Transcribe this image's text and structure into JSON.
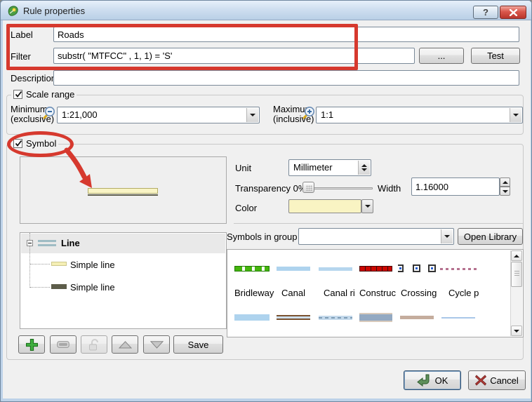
{
  "window": {
    "title": "Rule properties",
    "help": "?"
  },
  "form": {
    "label": {
      "name": "Label",
      "value": "Roads"
    },
    "filter": {
      "name": "Filter",
      "value": "substr( \"MTFCC\" , 1, 1) = 'S'",
      "browse": "...",
      "test": "Test"
    },
    "description": {
      "name": "Description",
      "value": ""
    }
  },
  "scale_range": {
    "title": "Scale range",
    "minimum": {
      "line1": "Minimum",
      "line2": "(exclusive)",
      "value": "1:21,000"
    },
    "maximum": {
      "line1": "Maximum",
      "line2": "(inclusive)",
      "value": "1:1"
    }
  },
  "symbol": {
    "title": "Symbol",
    "unit_label": "Unit",
    "unit_value": "Millimeter",
    "transparency_label": "Transparency 0%",
    "width_label": "Width",
    "width_value": "1.16000",
    "color_label": "Color",
    "tree": {
      "root": "Line",
      "children": [
        "Simple line",
        "Simple line"
      ]
    },
    "symbols_in_group_label": "Symbols in group",
    "symbols_in_group_value": "",
    "open_library": "Open Library",
    "gallery_labels": [
      "Bridleway",
      "Canal",
      "Canal ri",
      "Construc",
      "Crossing",
      "Cycle p"
    ],
    "save": "Save"
  },
  "actions": {
    "ok": "OK",
    "cancel": "Cancel"
  },
  "colors": {
    "annotation_red": "#d6392e",
    "symbol_fill_yellow": "#f9f4c5",
    "symbol_outline_olive": "#b2ac66",
    "symbol_dark_line": "#5e5e4b",
    "titlebar_blue": "#bdd2e8"
  }
}
